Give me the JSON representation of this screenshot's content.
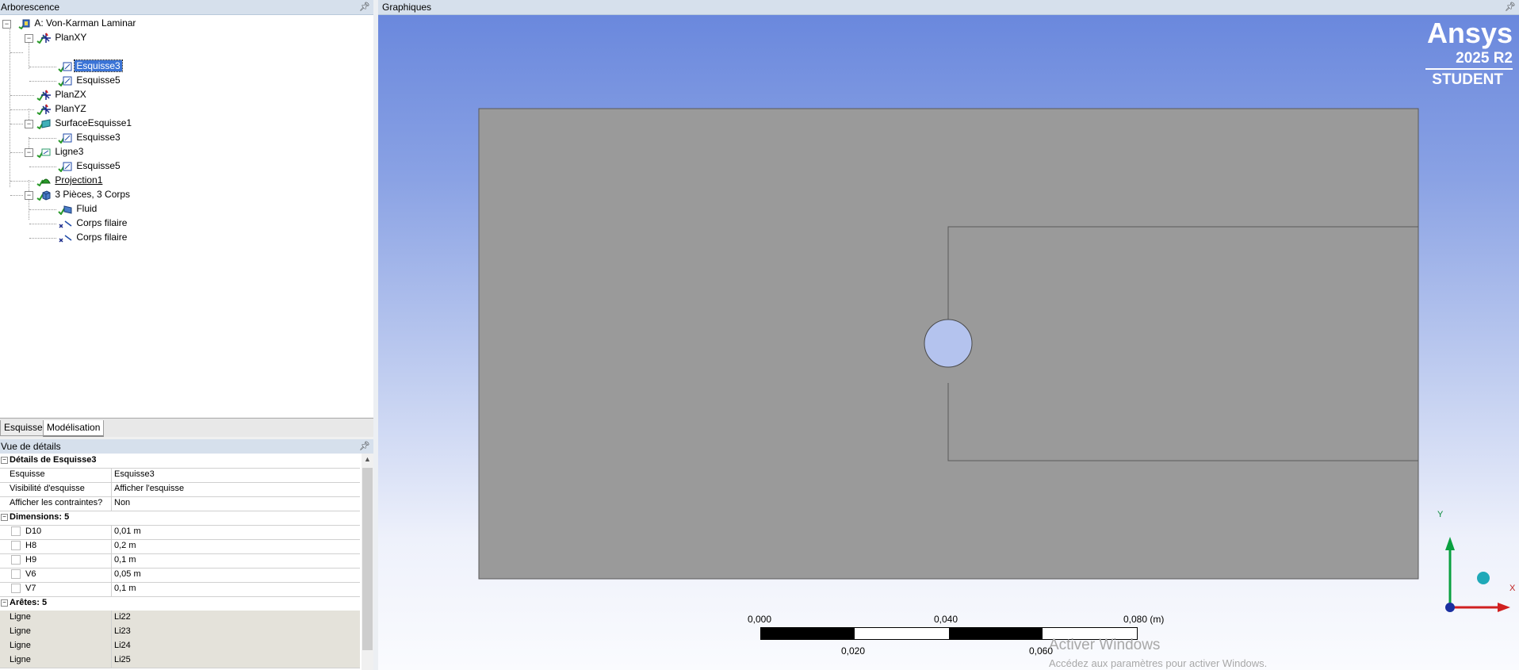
{
  "tree_panel": {
    "title": "Arborescence"
  },
  "graphics_panel": {
    "title": "Graphiques"
  },
  "tree": [
    {
      "label": "A: Von-Karman Laminar"
    },
    {
      "label": "PlanXY"
    },
    {
      "label": "Esquisse3"
    },
    {
      "label": "Esquisse5"
    },
    {
      "label": "PlanZX"
    },
    {
      "label": "PlanYZ"
    },
    {
      "label": "SurfaceEsquisse1"
    },
    {
      "label": "Esquisse3"
    },
    {
      "label": "Ligne3"
    },
    {
      "label": "Esquisse5"
    },
    {
      "label": "Projection1"
    },
    {
      "label": "3 Pièces, 3 Corps"
    },
    {
      "label": "Fluid"
    },
    {
      "label": "Corps filaire"
    },
    {
      "label": "Corps filaire"
    }
  ],
  "tabs": [
    {
      "label": "Esquisse"
    },
    {
      "label": "Modélisation"
    }
  ],
  "details": {
    "title": "Vue de détails",
    "group1": "Détails de Esquisse3",
    "rows1": [
      {
        "name": "Esquisse",
        "value": "Esquisse3"
      },
      {
        "name": "Visibilité d'esquisse",
        "value": "Afficher l'esquisse"
      },
      {
        "name": "Afficher les contraintes?",
        "value": "Non"
      }
    ],
    "group2": "Dimensions: 5",
    "rows2": [
      {
        "name": "D10",
        "value": "0,01 m"
      },
      {
        "name": "H8",
        "value": "0,2 m"
      },
      {
        "name": "H9",
        "value": "0,1 m"
      },
      {
        "name": "V6",
        "value": "0,05 m"
      },
      {
        "name": "V7",
        "value": "0,1 m"
      }
    ],
    "group3": "Arêtes: 5",
    "rows3": [
      {
        "name": "Ligne",
        "value": "Li22"
      },
      {
        "name": "Ligne",
        "value": "Li23"
      },
      {
        "name": "Ligne",
        "value": "Li24"
      },
      {
        "name": "Ligne",
        "value": "Li25"
      }
    ]
  },
  "brand": {
    "name": "Ansys",
    "version": "2025 R2",
    "edition": "STUDENT"
  },
  "scale_bar": {
    "top_labels": [
      "0,000",
      "0,040",
      "0,080 (m)"
    ],
    "bottom_labels": [
      "0,020",
      "0,060"
    ]
  },
  "axes": {
    "x": "X",
    "y": "Y"
  },
  "watermark": {
    "title": "Activer Windows",
    "subtitle": "Accédez aux paramètres pour activer Windows."
  },
  "colors": {
    "viewport_top": "#6a88dd",
    "geometry_fill": "#9a9a9a",
    "selection": "#3b74d6",
    "circle_fill": "#b4c3ee"
  }
}
